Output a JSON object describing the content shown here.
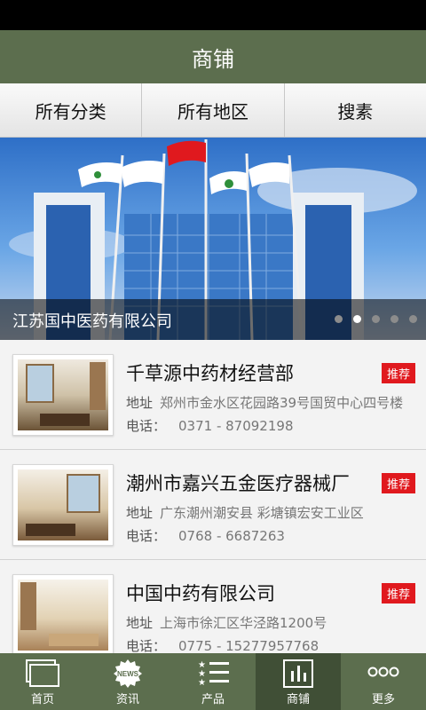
{
  "header": {
    "title": "商铺"
  },
  "filters": [
    {
      "label": "所有分类"
    },
    {
      "label": "所有地区"
    },
    {
      "label": "搜素"
    }
  ],
  "banner": {
    "caption": "江苏国中医药有限公司",
    "slides": 5,
    "active_slide": 2
  },
  "shops": [
    {
      "name": "千草源中药材经营部",
      "badge": "推荐",
      "address_label": "地址",
      "address": "郑州市金水区花园路39号国贸中心四号楼",
      "phone_label": "电话：",
      "phone": "0371 - 87092198"
    },
    {
      "name": "潮州市嘉兴五金医疗器械厂",
      "badge": "推荐",
      "address_label": "地址",
      "address": "广东潮州潮安县 彩塘镇宏安工业区",
      "phone_label": "电话：",
      "phone": "0768 - 6687263"
    },
    {
      "name": "中国中药有限公司",
      "badge": "推荐",
      "address_label": "地址",
      "address": "上海市徐汇区华泾路1200号",
      "phone_label": "电话：",
      "phone": "0775 - 15277957768"
    }
  ],
  "tabbar": [
    {
      "label": "首页",
      "icon": "home-icon"
    },
    {
      "label": "资讯",
      "icon": "news-icon",
      "icon_text": "NEWS"
    },
    {
      "label": "产品",
      "icon": "product-list-icon"
    },
    {
      "label": "商铺",
      "icon": "shop-chart-icon",
      "active": true
    },
    {
      "label": "更多",
      "icon": "more-icon"
    }
  ],
  "colors": {
    "theme": "#5c6e4e",
    "theme_active": "#404f36",
    "badge": "#e0191e"
  }
}
